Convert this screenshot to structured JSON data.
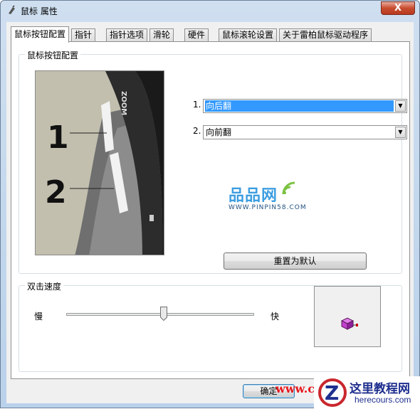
{
  "window": {
    "title": "鼠标 属性",
    "close_label": "X"
  },
  "tabs": [
    {
      "label": "鼠标按钮配置",
      "active": true
    },
    {
      "label": "指针"
    },
    {
      "label": "指针选项"
    },
    {
      "label": "滑轮"
    },
    {
      "label": "硬件"
    },
    {
      "label": "鼠标滚轮设置"
    },
    {
      "label": "关于雷柏鼠标驱动程序"
    }
  ],
  "button_config": {
    "group_title": "鼠标按钮配置",
    "image_labels": {
      "one": "1",
      "two": "2",
      "zoom": "ZOOM"
    },
    "button1": {
      "label": "1.",
      "value": "向后翻"
    },
    "button2": {
      "label": "2.",
      "value": "向前翻"
    },
    "reset_label": "重置为默认"
  },
  "double_click": {
    "group_title": "双击速度",
    "slow_label": "慢",
    "fast_label": "快",
    "speed_position": 0.52
  },
  "footer": {
    "ok_label": "确定"
  },
  "watermarks": {
    "pinpin": "品品网",
    "pinpin_url": "WWW.PINPIN58.COM",
    "red": "www.c",
    "site_zh": "这里教程网",
    "site_en": "herecours.com"
  },
  "colors": {
    "selection": "#3399ff",
    "close": "#c84c2e"
  }
}
